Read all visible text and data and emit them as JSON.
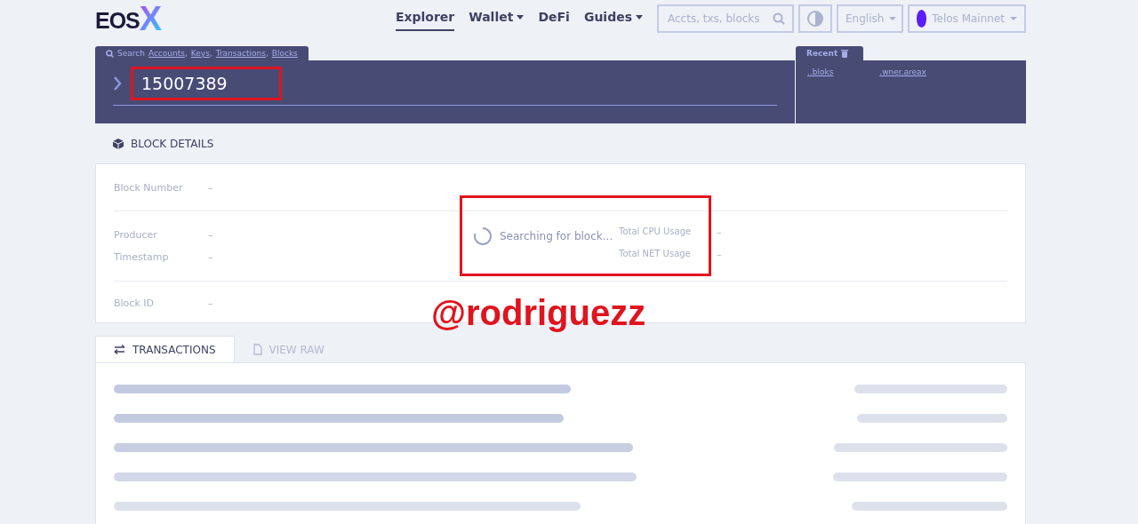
{
  "logo": {
    "text": "EOS",
    "mark": "X"
  },
  "nav": [
    {
      "label": "Explorer",
      "selected": true,
      "dropdown": false
    },
    {
      "label": "Wallet",
      "selected": false,
      "dropdown": true
    },
    {
      "label": "DeFi",
      "selected": false,
      "dropdown": false
    },
    {
      "label": "Guides",
      "selected": false,
      "dropdown": true
    }
  ],
  "header_search": {
    "placeholder": "Accts, txs, blocks"
  },
  "language": "English",
  "network": {
    "label": "Telos Mainnet",
    "color": "#5b1cff"
  },
  "search_panel": {
    "prefix": "Search",
    "links": [
      {
        "label": "Accounts",
        "separator": ","
      },
      {
        "label": "Keys",
        "separator": ","
      },
      {
        "label": "Transactions",
        "separator": ","
      },
      {
        "label": "Blocks"
      }
    ],
    "value": "15007389",
    "highlighted": true
  },
  "recent": {
    "title": "Recent",
    "items": [
      "..bloks",
      ".wner.areax"
    ]
  },
  "block_details": {
    "title": "BLOCK DETAILS",
    "field_groups": [
      [
        {
          "label": "Block Number",
          "value": "–"
        }
      ],
      [
        {
          "label": "Producer",
          "value": "–"
        },
        {
          "label": "Timestamp",
          "value": "–"
        }
      ],
      [
        {
          "label": "Block ID",
          "value": "–"
        }
      ]
    ],
    "right_fields": [
      {
        "label": "Total CPU Usage",
        "value": "–"
      },
      {
        "label": "Total NET Usage",
        "value": "–"
      }
    ],
    "loading": {
      "text": "Searching for block...",
      "highlighted": true
    }
  },
  "annotation_text": "@rodriguezz",
  "tabs": [
    {
      "label": "TRANSACTIONS",
      "selected": true,
      "kind": "transfer"
    },
    {
      "label": "VIEW RAW",
      "selected": false,
      "kind": "file"
    }
  ]
}
